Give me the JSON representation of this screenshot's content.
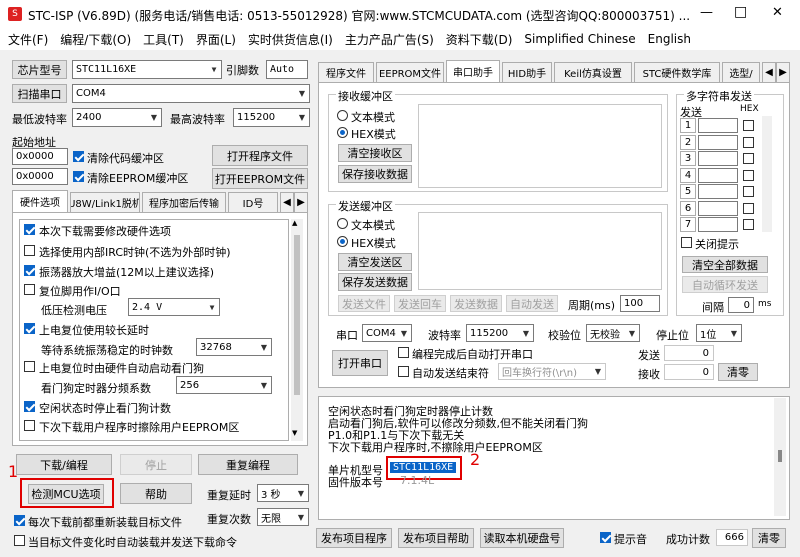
{
  "titlebar": {
    "title": "STC-ISP (V6.89D) (服务电话/销售电话: 0513-55012928) 官网:www.STCMCUDATA.com  (选型咨询QQ:800003751)  ...",
    "min": "—",
    "max": "□",
    "close": "✕"
  },
  "menu": [
    "文件(F)",
    "编程/下载(O)",
    "工具(T)",
    "界面(L)",
    "实时供货信息(I)",
    "主力产品广告(S)",
    "资料下载(D)",
    "Simplified Chinese",
    "English"
  ],
  "left": {
    "chip_label": "芯片型号",
    "chip_value": "STC11L16XE",
    "pin_label": "引脚数",
    "pin_value": "Auto",
    "scan_label": "扫描串口",
    "port_value": "COM4",
    "minbaud_label": "最低波特率",
    "minbaud_value": "2400",
    "maxbaud_label": "最高波特率",
    "maxbaud_value": "115200",
    "start_label": "起始地址",
    "addr1": "0x0000",
    "clear_code": "清除代码缓冲区",
    "open_prog": "打开程序文件",
    "addr2": "0x0000",
    "clear_eeprom": "清除EEPROM缓冲区",
    "open_eeprom": "打开EEPROM文件",
    "tabs": [
      "硬件选项",
      "U8W/Link1脱机",
      "程序加密后传输",
      "ID号"
    ],
    "options": [
      {
        "label": "本次下载需要修改硬件选项",
        "checked": true
      },
      {
        "label": "选择使用内部IRC时钟(不选为外部时钟)",
        "checked": false
      },
      {
        "label": "振荡器放大增益(12M以上建议选择)",
        "checked": true
      },
      {
        "label": "复位脚用作I/O口",
        "checked": false
      },
      {
        "label": "上电复位使用较长延时",
        "checked": true
      },
      {
        "label": "上电复位时由硬件自动启动看门狗",
        "checked": false
      },
      {
        "label": "空闲状态时停止看门狗计数",
        "checked": true
      },
      {
        "label": "下次下载用户程序时擦除用户EEPROM区",
        "checked": false
      }
    ],
    "lowvolt_label": "低压检测电压",
    "lowvolt_value": "2.4 V",
    "wait_label": "等待系统振荡稳定的时钟数",
    "wait_value": "32768",
    "wdt_label": "看门狗定时器分频系数",
    "wdt_value": "256",
    "download": "下载/编程",
    "stop": "停止",
    "reprog": "重复编程",
    "detect": "检测MCU选项",
    "help": "帮助",
    "delay_label": "重复延时",
    "delay_value": "3 秒",
    "reload": "每次下载前都重新装载目标文件",
    "count_label": "重复次数",
    "count_value": "无限",
    "autoload": "当目标文件变化时自动装载并发送下载命令",
    "mark1": "1"
  },
  "right": {
    "tabs": [
      "程序文件",
      "EEPROM文件",
      "串口助手",
      "HID助手",
      "Keil仿真设置",
      "STC硬件数学库",
      "选型/"
    ],
    "recv_title": "接收缓冲区",
    "text_mode": "文本模式",
    "hex_mode": "HEX模式",
    "clear_recv": "清空接收区",
    "save_recv": "保存接收数据",
    "send_title": "发送缓冲区",
    "clear_send": "清空发送区",
    "save_send": "保存发送数据",
    "send_file": "发送文件",
    "send_enter": "发送回车",
    "send_data": "发送数据",
    "auto_send": "自动发送",
    "period_label": "周期(ms)",
    "period_value": "100",
    "multi_title": "多字符串发送",
    "send_col": "发送",
    "hex_col": "HEX",
    "rows": [
      "1",
      "2",
      "3",
      "4",
      "5",
      "6",
      "7"
    ],
    "close_tip": "关闭提示",
    "clear_all": "清空全部数据",
    "auto_loop": "自动循环发送",
    "interval_label": "间隔",
    "interval_value": "0",
    "interval_unit": "ms",
    "port_label": "串口",
    "port_value": "COM4",
    "baud_label": "波特率",
    "baud_value": "115200",
    "parity_label": "校验位",
    "parity_value": "无校验",
    "stop_label": "停止位",
    "stop_value": "1位",
    "open_port": "打开串口",
    "auto_open": "编程完成后自动打开串口",
    "auto_end": "自动发送结束符",
    "end_value": "回车换行符(\\r\\n)",
    "sent_label": "发送",
    "sent_value": "0",
    "recv_label": "接收",
    "recv_value": "0",
    "clear_count": "清零",
    "log": [
      "空闲状态时看门狗定时器停止计数",
      "启动看门狗后,软件可以修改分频数,但不能关闭看门狗",
      "P1.0和P1.1与下次下载无关",
      "下次下载用户程序时,不擦除用户EEPROM区"
    ],
    "chip_label": "单片机型号",
    "chip_value": "STC11L16XE",
    "fw_label": "固件版本号",
    "fw_value": "7.1.4L",
    "mark2": "2",
    "publish_prog": "发布项目程序",
    "publish_help": "发布项目帮助",
    "read_disk": "读取本机硬盘号",
    "beep": "提示音",
    "success_label": "成功计数",
    "success_value": "666",
    "clear_success": "清零"
  }
}
